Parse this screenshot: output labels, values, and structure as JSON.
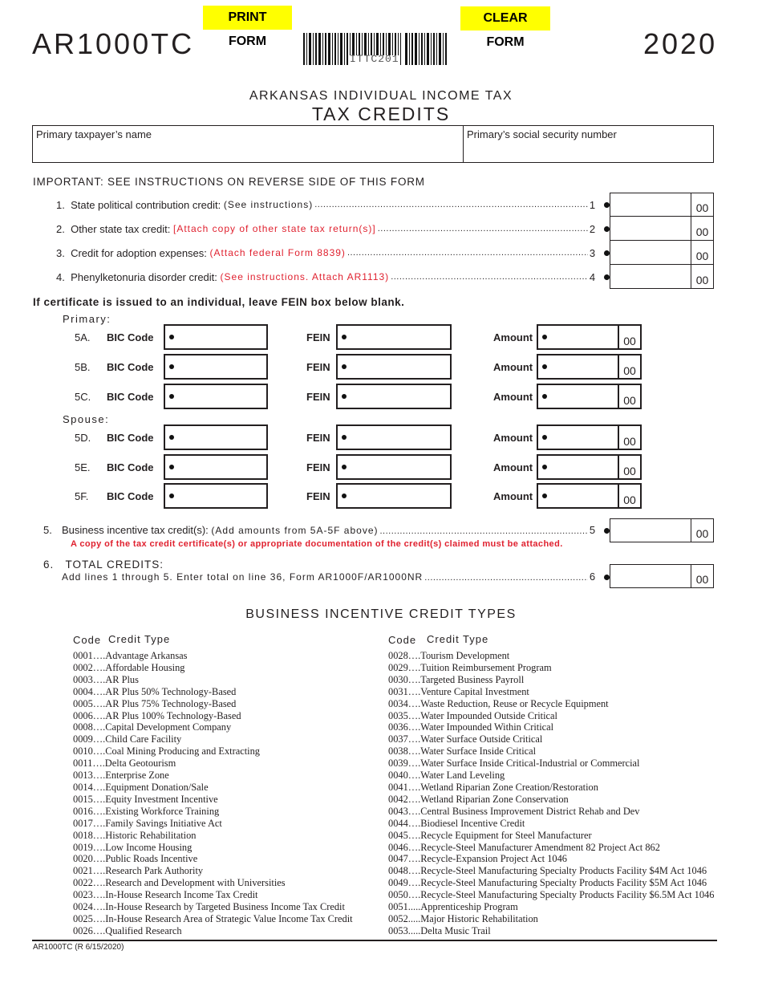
{
  "header": {
    "print_button": "PRINT FORM",
    "clear_button": "CLEAR FORM",
    "form_id": "AR1000TC",
    "year": "2020",
    "barcode_text": "ITTC201",
    "subtitle": "ARKANSAS INDIVIDUAL INCOME TAX",
    "title": "TAX CREDITS"
  },
  "taxpayer": {
    "name_label": "Primary taxpayer’s name",
    "name_value": "",
    "ssn_label": "Primary’s social security number",
    "ssn_value": ""
  },
  "important_note": "IMPORTANT: SEE INSTRUCTIONS ON REVERSE SIDE OF THIS FORM",
  "lines": [
    {
      "num": "1.",
      "label": "State political contribution credit:",
      "note": "(See instructions)",
      "note_red": false,
      "line_no": "1",
      "value": "",
      "cents": "00"
    },
    {
      "num": "2.",
      "label": "Other state tax credit:",
      "note": "[Attach copy of other state tax return(s)]",
      "note_red": true,
      "line_no": "2",
      "value": "",
      "cents": "00"
    },
    {
      "num": "3.",
      "label": "Credit for adoption expenses:",
      "note": "(Attach federal Form 8839)",
      "note_red": true,
      "line_no": "3",
      "value": "",
      "cents": "00"
    },
    {
      "num": "4.",
      "label": "Phenylketonuria disorder credit:",
      "note": "(See instructions. Attach AR1113)",
      "note_red": true,
      "line_no": "4",
      "value": "",
      "cents": "00"
    }
  ],
  "fein_note": "If certificate is issued to an individual, leave FEIN box below blank.",
  "bic": {
    "primary_label": "Primary:",
    "spouse_label": "Spouse:",
    "bic_label": "BIC Code",
    "fein_label": "FEIN",
    "amount_label": "Amount",
    "rows": [
      {
        "id": "5A.",
        "bic": "",
        "fein": "",
        "amount": "",
        "cents": "00"
      },
      {
        "id": "5B.",
        "bic": "",
        "fein": "",
        "amount": "",
        "cents": "00"
      },
      {
        "id": "5C.",
        "bic": "",
        "fein": "",
        "amount": "",
        "cents": "00"
      },
      {
        "id": "5D.",
        "bic": "",
        "fein": "",
        "amount": "",
        "cents": "00"
      },
      {
        "id": "5E.",
        "bic": "",
        "fein": "",
        "amount": "",
        "cents": "00"
      },
      {
        "id": "5F.",
        "bic": "",
        "fein": "",
        "amount": "",
        "cents": "00"
      }
    ]
  },
  "line5": {
    "num": "5.",
    "label": "Business incentive tax credit(s):",
    "note": "(Add amounts from 5A-5F above)",
    "line_no": "5",
    "value": "",
    "cents": "00",
    "warning": "A copy of the tax credit certificate(s) or appropriate documentation of the credit(s) claimed must be attached."
  },
  "line6": {
    "num": "6.",
    "label": "TOTAL CREDITS:",
    "instruction": "Add lines 1 through 5. Enter total on line 36, Form AR1000F/AR1000NR",
    "line_no": "6",
    "value": "",
    "cents": "00"
  },
  "credit_types": {
    "title": "BUSINESS INCENTIVE CREDIT TYPES",
    "code_header": "Code",
    "type_header": "Credit Type",
    "left": [
      "0001….Advantage Arkansas",
      "0002….Affordable Housing",
      "0003….AR Plus",
      "0004….AR Plus 50% Technology-Based",
      "0005….AR Plus 75% Technology-Based",
      "0006….AR Plus 100% Technology-Based",
      "0008….Capital Development Company",
      "0009….Child Care Facility",
      "0010….Coal Mining Producing and Extracting",
      "0011….Delta Geotourism",
      "0013….Enterprise Zone",
      "0014….Equipment Donation/Sale",
      "0015….Equity Investment Incentive",
      "0016….Existing Workforce Training",
      "0017….Family Savings Initiative Act",
      "0018….Historic Rehabilitation",
      "0019….Low Income Housing",
      "0020….Public Roads Incentive",
      "0021….Research Park Authority",
      "0022….Research and Development with Universities",
      "0023….In-House Research Income Tax Credit",
      "0024….In-House Research by Targeted Business Income Tax Credit",
      "0025….In-House Research Area of Strategic Value Income Tax Credit",
      "0026….Qualified Research"
    ],
    "right": [
      "0028….Tourism Development",
      "0029….Tuition Reimbursement Program",
      "0030….Targeted Business Payroll",
      "0031….Venture Capital Investment",
      "0034….Waste Reduction, Reuse or Recycle Equipment",
      "0035….Water Impounded Outside Critical",
      "0036….Water Impounded Within Critical",
      "0037….Water Surface Outside Critical",
      "0038….Water Surface Inside Critical",
      "0039….Water Surface Inside Critical-Industrial or Commercial",
      "0040….Water Land Leveling",
      "0041….Wetland Riparian Zone Creation/Restoration",
      "0042….Wetland Riparian Zone Conservation",
      "0043….Central Business Improvement District Rehab and Dev",
      "0044….Biodiesel Incentive Credit",
      "0045….Recycle Equipment for Steel Manufacturer",
      "0046….Recycle-Steel Manufacturer Amendment 82 Project Act 862",
      "0047….Recycle-Expansion Project Act 1046",
      "0048….Recycle-Steel Manufacturing Specialty Products Facility $4M Act 1046",
      "0049….Recycle-Steel Manufacturing Specialty Products Facility $5M Act 1046",
      "0050….Recycle-Steel Manufacturing Specialty Products Facility $6.5M Act 1046",
      "0051.....Apprenticeship Program",
      "0052.....Major Historic Rehabilitation",
      "0053.....Delta Music Trail"
    ]
  },
  "footer": {
    "revision": "AR1000TC (R 6/15/2020)"
  }
}
